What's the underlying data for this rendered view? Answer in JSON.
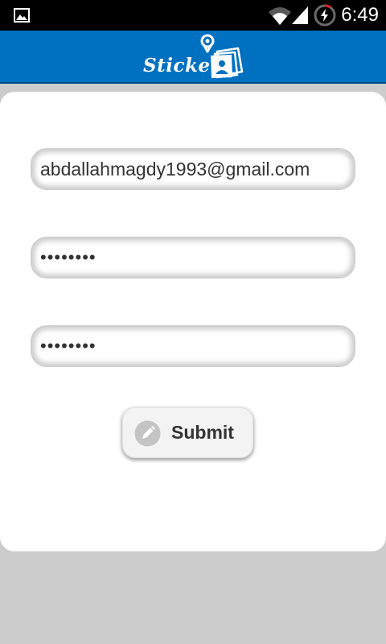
{
  "status_bar": {
    "time": "6:49",
    "icons": [
      "gallery-icon",
      "wifi-icon",
      "cell-signal-icon",
      "battery-charging-icon"
    ]
  },
  "header": {
    "logo_text": "Sticker",
    "logo_icon": "photo-stack-pin-icon",
    "background_color": "#0070c0"
  },
  "form": {
    "email_value": "abdallahmagdy1993@gmail.com",
    "password_value": "12345678",
    "confirm_password_value": "12345678",
    "submit_label": "Submit",
    "submit_icon": "pencil-icon"
  }
}
